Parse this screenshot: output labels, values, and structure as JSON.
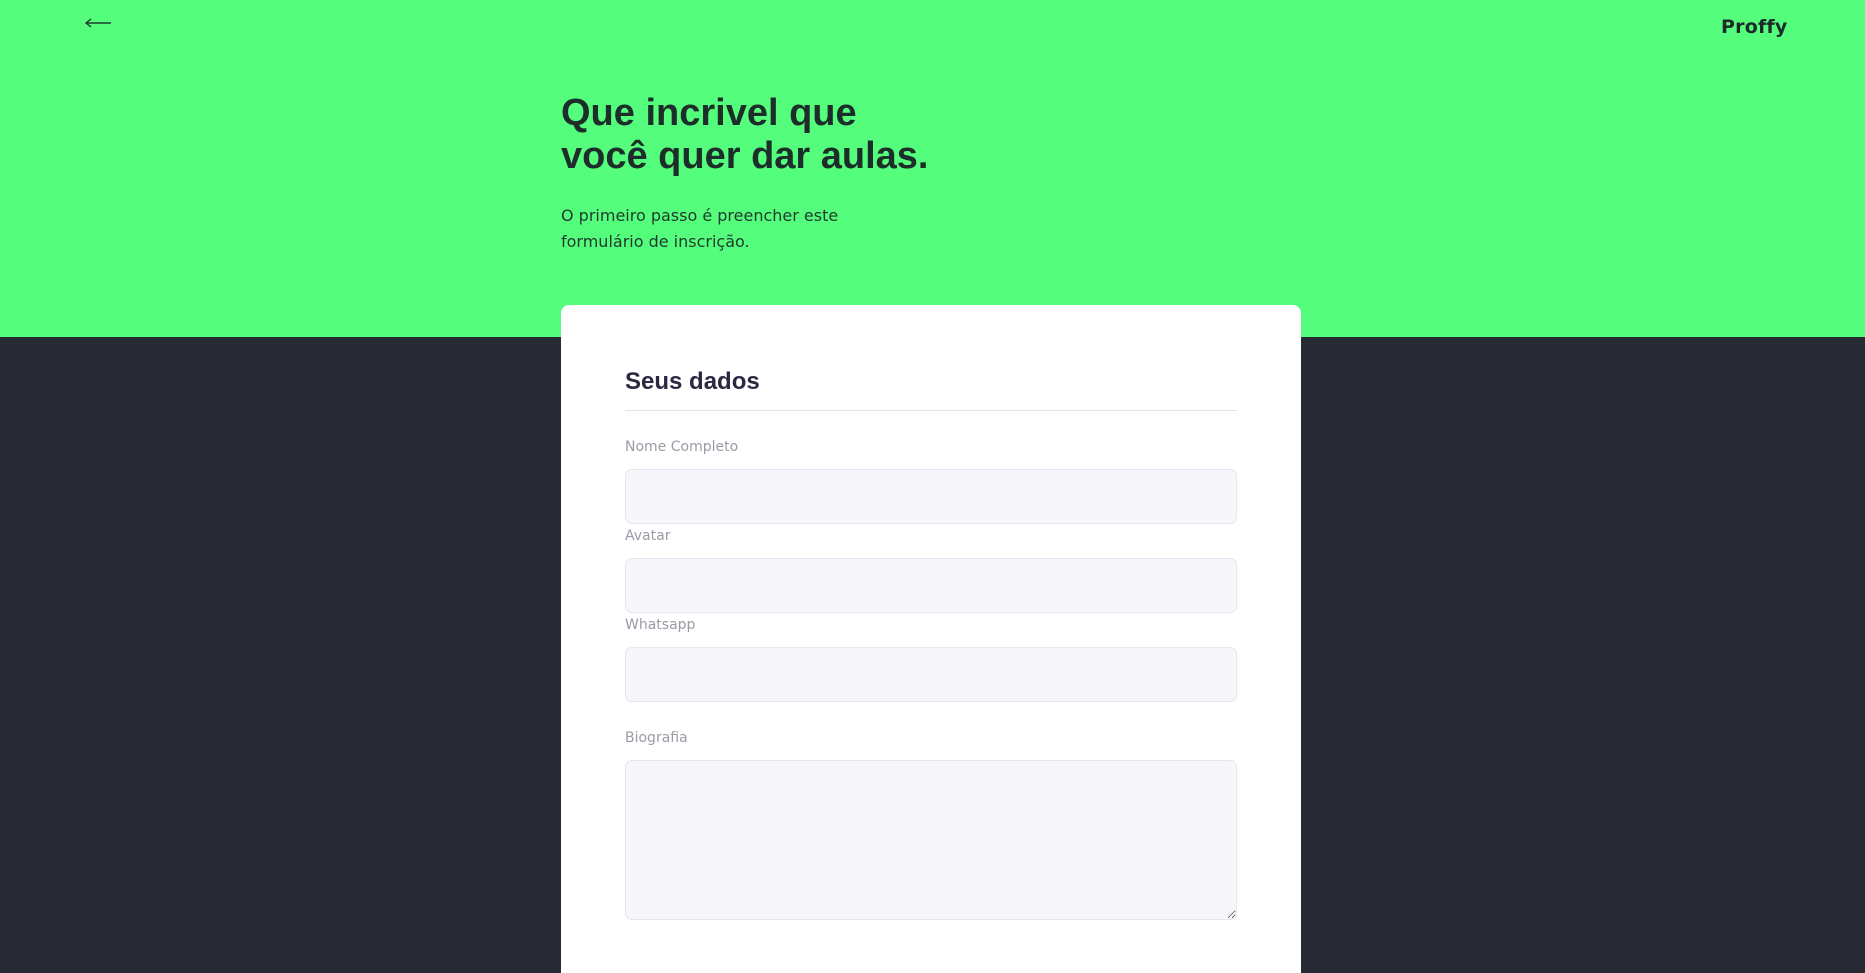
{
  "header": {
    "back_icon": "arrow-left-icon",
    "logo_text": "Proffy"
  },
  "hero": {
    "title_line1": "Que incrivel que",
    "title_line2": "você quer dar aulas.",
    "subtitle_line1": "O primeiro passo é preencher este",
    "subtitle_line2": "formulário de inscrição."
  },
  "form": {
    "section_title": "Seus dados",
    "fields": [
      {
        "label": "Nome Completo",
        "value": ""
      },
      {
        "label": "Avatar",
        "value": ""
      },
      {
        "label": "Whatsapp",
        "value": ""
      },
      {
        "label": "Biografia",
        "value": ""
      }
    ]
  },
  "colors": {
    "hero_background": "#54fd7c",
    "page_background": "#272935",
    "card_background": "#ffffff",
    "input_background": "#f7f7fb"
  }
}
